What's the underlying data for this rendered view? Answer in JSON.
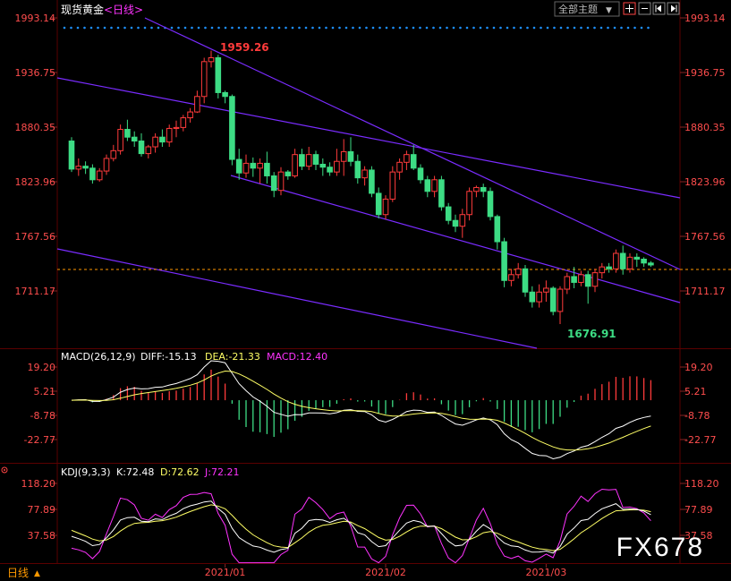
{
  "header": {
    "symbol": "现货黄金",
    "period_link": "<日线>",
    "theme_dropdown": "全部主题",
    "theme_arrow": "▼",
    "icons": [
      "crosshair-icon",
      "zoom-out-icon",
      "step-back-icon",
      "step-forward-icon"
    ]
  },
  "colors": {
    "up": "#ff3b3b",
    "down": "#3ddc84",
    "axis_text": "#ff4d4d",
    "trendline": "#7a2cff",
    "diff_line": "#ffffff",
    "dea_line": "#ffff66",
    "k_line": "#ffffff",
    "d_line": "#ffff66",
    "j_line": "#ff33ff",
    "dotted_row": "#1e90ff",
    "price_marker": "#ff9900"
  },
  "main_chart": {
    "y_ticks": [
      "1993.14",
      "1936.75",
      "1880.35",
      "1823.96",
      "1767.56",
      "1711.17"
    ],
    "high_label": "1959.26",
    "low_label": "1676.91",
    "current_price": 1727
  },
  "chart_data": [
    {
      "type": "candlestick",
      "title": "现货黄金<日线>",
      "ylim": [
        1670,
        1995
      ],
      "x_ticks": [
        "2021/01",
        "2021/02",
        "2021/03"
      ],
      "ohlc": [
        [
          1866,
          1870,
          1834,
          1837
        ],
        [
          1837,
          1848,
          1830,
          1840
        ],
        [
          1840,
          1845,
          1832,
          1838
        ],
        [
          1838,
          1842,
          1822,
          1826
        ],
        [
          1826,
          1838,
          1824,
          1835
        ],
        [
          1835,
          1852,
          1831,
          1848
        ],
        [
          1848,
          1862,
          1845,
          1856
        ],
        [
          1856,
          1883,
          1852,
          1878
        ],
        [
          1878,
          1888,
          1866,
          1870
        ],
        [
          1870,
          1876,
          1860,
          1866
        ],
        [
          1866,
          1874,
          1850,
          1853
        ],
        [
          1853,
          1862,
          1848,
          1860
        ],
        [
          1860,
          1874,
          1854,
          1870
        ],
        [
          1870,
          1878,
          1860,
          1865
        ],
        [
          1865,
          1883,
          1860,
          1879
        ],
        [
          1879,
          1887,
          1870,
          1880
        ],
        [
          1880,
          1893,
          1876,
          1890
        ],
        [
          1890,
          1900,
          1885,
          1896
        ],
        [
          1896,
          1918,
          1895,
          1912
        ],
        [
          1912,
          1952,
          1905,
          1948
        ],
        [
          1948,
          1959.26,
          1942,
          1952
        ],
        [
          1952,
          1955,
          1910,
          1916
        ],
        [
          1916,
          1918,
          1905,
          1912
        ],
        [
          1912,
          1914,
          1841,
          1847
        ],
        [
          1847,
          1858,
          1826,
          1833
        ],
        [
          1833,
          1852,
          1828,
          1843
        ],
        [
          1843,
          1849,
          1829,
          1838
        ],
        [
          1838,
          1848,
          1822,
          1843
        ],
        [
          1843,
          1855,
          1822,
          1830
        ],
        [
          1830,
          1834,
          1808,
          1815
        ],
        [
          1815,
          1839,
          1810,
          1834
        ],
        [
          1834,
          1836,
          1826,
          1830
        ],
        [
          1830,
          1858,
          1828,
          1852
        ],
        [
          1852,
          1858,
          1836,
          1840
        ],
        [
          1840,
          1860,
          1836,
          1852
        ],
        [
          1852,
          1856,
          1836,
          1842
        ],
        [
          1842,
          1848,
          1830,
          1839
        ],
        [
          1839,
          1844,
          1830,
          1834
        ],
        [
          1834,
          1858,
          1830,
          1845
        ],
        [
          1845,
          1868,
          1830,
          1855
        ],
        [
          1855,
          1870,
          1840,
          1845
        ],
        [
          1845,
          1852,
          1822,
          1828
        ],
        [
          1828,
          1840,
          1820,
          1836
        ],
        [
          1836,
          1840,
          1808,
          1812
        ],
        [
          1812,
          1818,
          1786,
          1790
        ],
        [
          1790,
          1810,
          1785,
          1806
        ],
        [
          1806,
          1840,
          1803,
          1834
        ],
        [
          1834,
          1848,
          1826,
          1844
        ],
        [
          1844,
          1856,
          1836,
          1852
        ],
        [
          1852,
          1862,
          1836,
          1838
        ],
        [
          1838,
          1842,
          1822,
          1826
        ],
        [
          1826,
          1830,
          1808,
          1814
        ],
        [
          1814,
          1830,
          1808,
          1826
        ],
        [
          1826,
          1830,
          1794,
          1798
        ],
        [
          1798,
          1802,
          1780,
          1784
        ],
        [
          1784,
          1790,
          1772,
          1778
        ],
        [
          1778,
          1796,
          1766,
          1790
        ],
        [
          1790,
          1818,
          1784,
          1814
        ],
        [
          1814,
          1820,
          1808,
          1818
        ],
        [
          1818,
          1822,
          1808,
          1814
        ],
        [
          1814,
          1818,
          1784,
          1788
        ],
        [
          1788,
          1790,
          1754,
          1762
        ],
        [
          1762,
          1766,
          1715,
          1722
        ],
        [
          1722,
          1734,
          1716,
          1728
        ],
        [
          1728,
          1740,
          1724,
          1734
        ],
        [
          1734,
          1738,
          1705,
          1710
        ],
        [
          1710,
          1716,
          1694,
          1700
        ],
        [
          1700,
          1718,
          1694,
          1710
        ],
        [
          1710,
          1722,
          1700,
          1714
        ],
        [
          1714,
          1716,
          1686,
          1690
        ],
        [
          1690,
          1716,
          1677,
          1713
        ],
        [
          1713,
          1730,
          1708,
          1726
        ],
        [
          1726,
          1736,
          1714,
          1720
        ],
        [
          1720,
          1732,
          1716,
          1728
        ],
        [
          1728,
          1732,
          1698,
          1716
        ],
        [
          1716,
          1734,
          1710,
          1730
        ],
        [
          1730,
          1740,
          1724,
          1736
        ],
        [
          1736,
          1740,
          1730,
          1734
        ],
        [
          1734,
          1754,
          1730,
          1750
        ],
        [
          1750,
          1758,
          1728,
          1734
        ],
        [
          1734,
          1750,
          1730,
          1746
        ],
        [
          1746,
          1750,
          1736,
          1744
        ],
        [
          1744,
          1746,
          1736,
          1740
        ],
        [
          1740,
          1742,
          1736,
          1738
        ]
      ]
    },
    {
      "type": "bar",
      "title": "MACD(26,12,9)",
      "series": [
        {
          "name": "DIFF",
          "last": -15.13
        },
        {
          "name": "DEA",
          "last": -21.33
        },
        {
          "name": "MACD",
          "last": 12.4
        }
      ],
      "y_ticks": [
        "19.20",
        "5.21",
        "-8.78",
        "-22.77"
      ],
      "ylim": [
        -40,
        25
      ]
    },
    {
      "type": "line",
      "title": "KDJ(9,3,3)",
      "series": [
        {
          "name": "K",
          "last": 72.48
        },
        {
          "name": "D",
          "last": 72.62
        },
        {
          "name": "J",
          "last": 72.21
        }
      ],
      "y_ticks": [
        "118.20",
        "77.89",
        "37.58"
      ],
      "ylim": [
        -5,
        125
      ]
    }
  ],
  "macd_panel": {
    "name": "MACD(26,12,9)",
    "diff_text": "DIFF:-15.13",
    "dea_text": "DEA:-21.33",
    "macd_text": "MACD:12.40"
  },
  "kdj_panel": {
    "name": "KDJ(9,3,3)",
    "k_text": "K:72.48",
    "d_text": "D:72.62",
    "j_text": "J:72.21"
  },
  "footer": {
    "period_button": "日线",
    "period_arrow": "▲",
    "x_ticks": [
      "2021/01",
      "2021/02",
      "2021/03"
    ]
  },
  "watermark": "FX678"
}
